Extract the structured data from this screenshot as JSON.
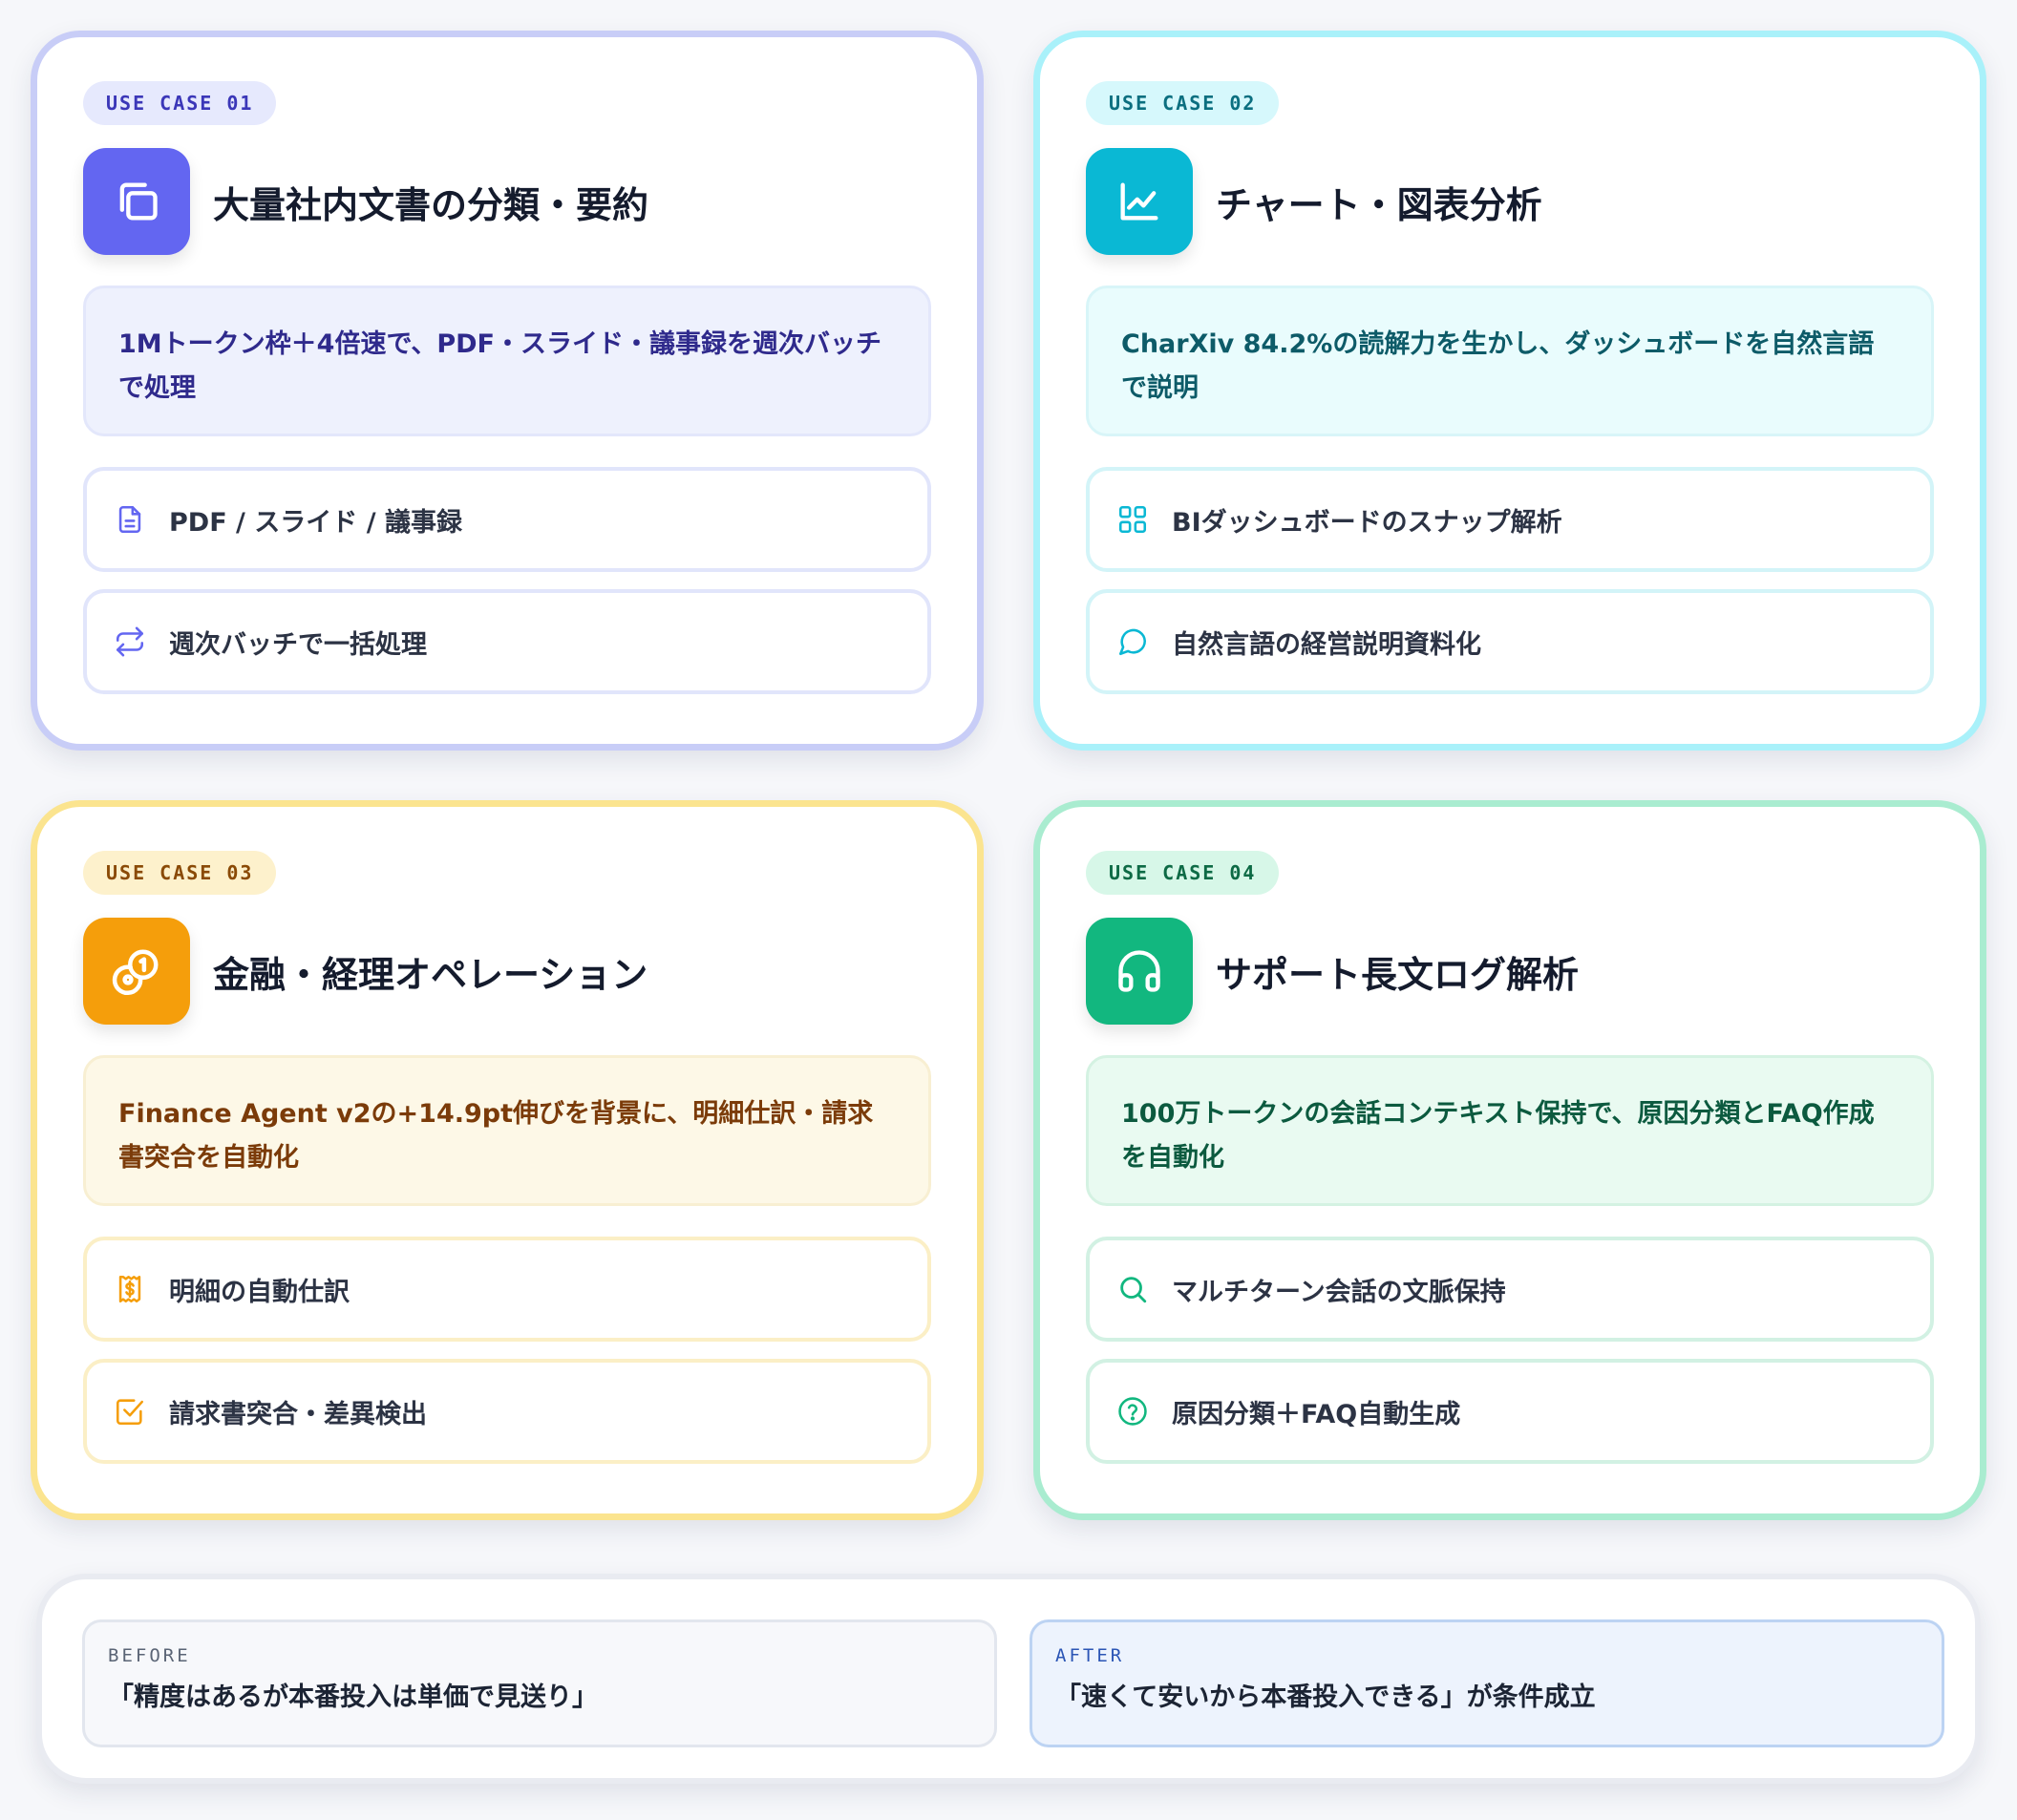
{
  "cards": [
    {
      "badge": "USE CASE 01",
      "icon": "copy-icon",
      "title": "大量社内文書の分類・要約",
      "desc": "1Mトークン枠＋4倍速で、PDF・スライド・議事録を週次バッチで処理",
      "items": [
        {
          "icon": "document-icon",
          "label": "PDF / スライド / 議事録"
        },
        {
          "icon": "repeat-icon",
          "label": "週次バッチで一括処理"
        }
      ],
      "accent": "#6366f1"
    },
    {
      "badge": "USE CASE 02",
      "icon": "line-chart-icon",
      "title": "チャート・図表分析",
      "desc": "CharXiv 84.2%の読解力を生かし、ダッシュボードを自然言語で説明",
      "items": [
        {
          "icon": "dashboard-grid-icon",
          "label": "BIダッシュボードのスナップ解析"
        },
        {
          "icon": "chat-bubble-icon",
          "label": "自然言語の経営説明資料化"
        }
      ],
      "accent": "#0ab8d4"
    },
    {
      "badge": "USE CASE 03",
      "icon": "coins-icon",
      "title": "金融・経理オペレーション",
      "desc": "Finance Agent v2の+14.9pt伸びを背景に、明細仕訳・請求書突合を自動化",
      "items": [
        {
          "icon": "receipt-icon",
          "label": "明細の自動仕訳"
        },
        {
          "icon": "checkbox-icon",
          "label": "請求書突合・差異検出"
        }
      ],
      "accent": "#f59e0b"
    },
    {
      "badge": "USE CASE 04",
      "icon": "headphones-icon",
      "title": "サポート長文ログ解析",
      "desc": "100万トークンの会話コンテキスト保持で、原因分類とFAQ作成を自動化",
      "items": [
        {
          "icon": "search-icon",
          "label": "マルチターン会話の文脈保持"
        },
        {
          "icon": "help-circle-icon",
          "label": "原因分類＋FAQ自動生成"
        }
      ],
      "accent": "#12b77f"
    }
  ],
  "summary": {
    "before_label": "BEFORE",
    "before_text": "「精度はあるが本番投入は単価で見送り」",
    "after_label": "AFTER",
    "after_text": "「速くて安いから本番投入できる」が条件成立"
  }
}
